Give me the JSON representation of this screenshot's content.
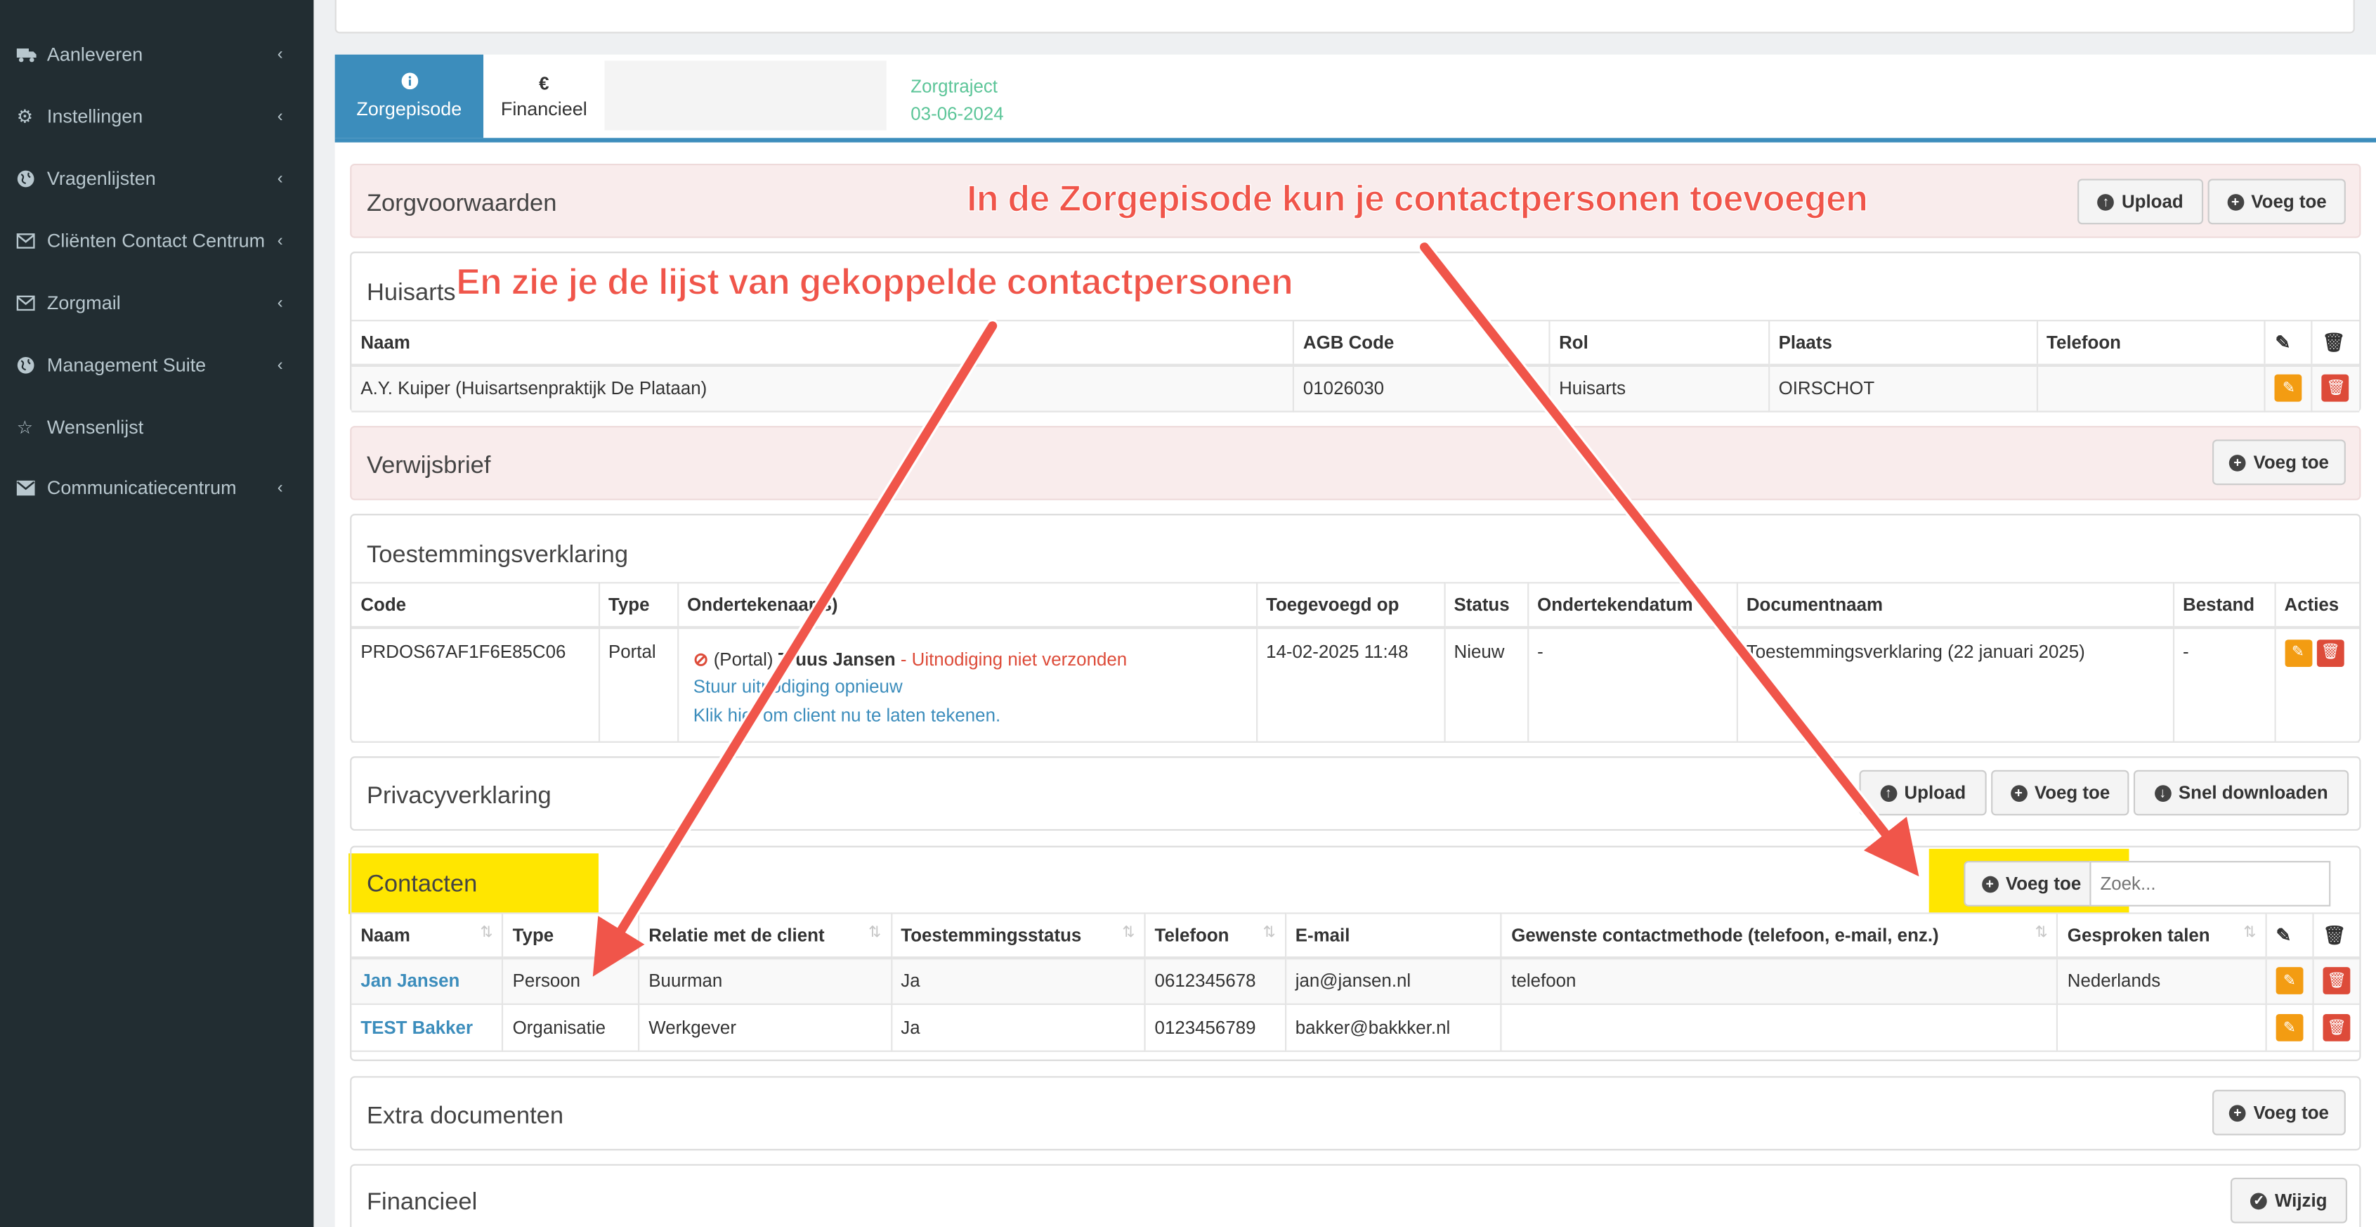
{
  "sidebar": {
    "items": [
      {
        "label": "Aanleveren",
        "icon": "truck-icon"
      },
      {
        "label": "Instellingen",
        "icon": "gear-icon"
      },
      {
        "label": "Vragenlijsten",
        "icon": "globe-icon"
      },
      {
        "label": "Cliënten Contact Centrum",
        "icon": "envelope-icon"
      },
      {
        "label": "Zorgmail",
        "icon": "envelope-icon"
      },
      {
        "label": "Management Suite",
        "icon": "globe-icon"
      },
      {
        "label": "Wensenlijst",
        "icon": "star-icon"
      },
      {
        "label": "Communicatiecentrum",
        "icon": "envelope-icon"
      }
    ]
  },
  "tabs": {
    "zorgepisode": "Zorgepisode",
    "financieel": "Financieel",
    "financieel_symbol": "€",
    "zorgtraject_label": "Zorgtraject",
    "zorgtraject_date": "03-06-2024"
  },
  "sections": {
    "zorgvoorwaarden": {
      "title": "Zorgvoorwaarden",
      "upload": "Upload",
      "add": "Voeg toe"
    },
    "huisarts": {
      "title": "Huisarts",
      "headers": [
        "Naam",
        "AGB Code",
        "Rol",
        "Plaats",
        "Telefoon"
      ],
      "row": {
        "naam": "A.Y. Kuiper (Huisartsenpraktijk De Plataan)",
        "agb": "01026030",
        "rol": "Huisarts",
        "plaats": "OIRSCHOT",
        "telefoon": ""
      }
    },
    "verwijsbrief": {
      "title": "Verwijsbrief",
      "add": "Voeg toe"
    },
    "toestemming": {
      "title": "Toestemmingsverklaring",
      "headers": [
        "Code",
        "Type",
        "Ondertekenaar(s)",
        "Toegevoegd op",
        "Status",
        "Ondertekendatum",
        "Documentnaam",
        "Bestand",
        "Acties"
      ],
      "row": {
        "code": "PRDOS67AF1F6E85C06",
        "type": "Portal",
        "signer_prefix": "(Portal)",
        "signer_name": "Truus Jansen",
        "signer_sep": " - ",
        "signer_status": "Uitnodiging niet verzonden",
        "resend": "Stuur uitnodiging opnieuw",
        "sign_now": "Klik hier om client nu te laten tekenen.",
        "added": "14-02-2025 11:48",
        "status": "Nieuw",
        "signdate": "-",
        "docname": "Toestemmingsverklaring (22 januari 2025)",
        "file": "-"
      }
    },
    "privacy": {
      "title": "Privacyverklaring",
      "upload": "Upload",
      "add": "Voeg toe",
      "download": "Snel downloaden"
    },
    "contacten": {
      "title": "Contacten",
      "add": "Voeg toe",
      "search_placeholder": "Zoek...",
      "headers": [
        "Naam",
        "Type",
        "Relatie met de client",
        "Toestemmingsstatus",
        "Telefoon",
        "E-mail",
        "Gewenste contactmethode (telefoon, e-mail, enz.)",
        "Gesproken talen"
      ],
      "rows": [
        {
          "naam": "Jan Jansen",
          "type": "Persoon",
          "relatie": "Buurman",
          "status": "Ja",
          "telefoon": "0612345678",
          "email": "jan@jansen.nl",
          "methode": "telefoon",
          "talen": "Nederlands"
        },
        {
          "naam": "TEST Bakker",
          "type": "Organisatie",
          "relatie": "Werkgever",
          "status": "Ja",
          "telefoon": "0123456789",
          "email": "bakker@bakkker.nl",
          "methode": "",
          "talen": ""
        }
      ]
    },
    "extra": {
      "title": "Extra documenten",
      "add": "Voeg toe"
    },
    "financieel": {
      "title": "Financieel",
      "edit": "Wijzig"
    }
  },
  "annotations": {
    "a1": "In de Zorgepisode kun je contactpersonen toevoegen",
    "a2": "En zie je de lijst van gekoppelde contactpersonen"
  },
  "colors": {
    "accent": "#3c8dbc",
    "highlight": "#ffe600",
    "annotation": "#f0554a",
    "sidebar": "#222d32"
  }
}
